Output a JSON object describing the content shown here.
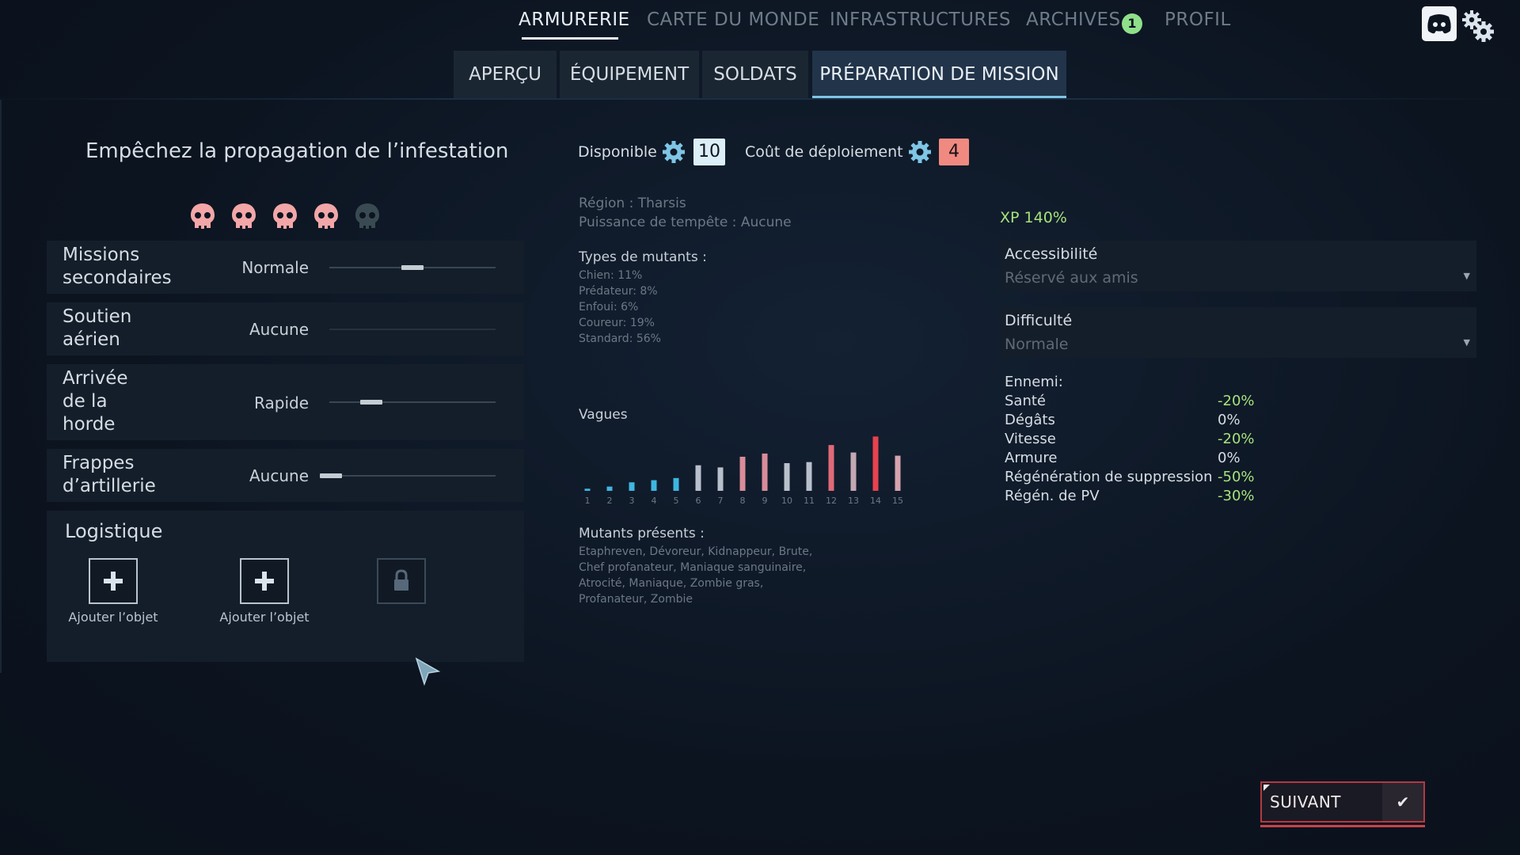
{
  "nav": {
    "items": [
      "ARMURERIE",
      "CARTE DU MONDE",
      "INFRASTRUCTURES",
      "ARCHIVES",
      "PROFIL"
    ],
    "active": "ARMURERIE",
    "archives_badge": "1"
  },
  "subtabs": [
    "APERÇU",
    "ÉQUIPEMENT",
    "SOLDATS",
    "PRÉPARATION DE MISSION"
  ],
  "active_subtab": "PRÉPARATION DE MISSION",
  "mission": {
    "title": "Empêchez la propagation de l’infestation",
    "difficulty_skulls_filled": 4,
    "difficulty_skulls_total": 5,
    "options": [
      {
        "label": "Missions secondaires",
        "value": "Normale",
        "level": 0.5
      },
      {
        "label": "Soutien aérien",
        "value": "Aucune",
        "level": null
      },
      {
        "label": "Arrivée de la horde",
        "value": "Rapide",
        "level": 0.25
      },
      {
        "label": "Frappes d’artillerie",
        "value": "Aucune",
        "level": 0.0
      }
    ],
    "logistics": {
      "title": "Logistique",
      "slots": [
        {
          "label": "Ajouter l’objet",
          "state": "add"
        },
        {
          "label": "Ajouter l’objet",
          "state": "add"
        },
        {
          "label": "",
          "state": "locked"
        }
      ]
    }
  },
  "resources": {
    "available_label": "Disponible",
    "available_value": "10",
    "cost_label": "Coût de déploiement",
    "cost_value": "4"
  },
  "info": {
    "region": "Région : Tharsis",
    "storm": "Puissance de tempête :  Aucune",
    "mutant_types_title": "Types de mutants :",
    "mutant_types": [
      "Chien:  11%",
      "Prédateur:  8%",
      "Enfoui:  6%",
      "Coureur:  19%",
      "Standard:  56%"
    ],
    "waves_title": "Vagues",
    "present_title": "Mutants présents :",
    "present_lines": [
      "Etaphreven, Dévoreur, Kidnappeur, Brute,",
      "Chef profanateur, Maniaque sanguinaire,",
      "Atrocité, Maniaque, Zombie gras,",
      "Profanateur, Zombie"
    ]
  },
  "chart_data": {
    "type": "bar",
    "categories": [
      "1",
      "2",
      "3",
      "4",
      "5",
      "6",
      "7",
      "8",
      "9",
      "10",
      "11",
      "12",
      "13",
      "14",
      "15"
    ],
    "values": [
      2,
      4,
      8,
      10,
      12,
      24,
      22,
      32,
      35,
      26,
      27,
      43,
      36,
      51,
      33
    ],
    "colors": [
      "#3fb7e0",
      "#3fb7e0",
      "#3fb7e0",
      "#3fb7e0",
      "#3fb7e0",
      "#b8c0cc",
      "#b8c0cc",
      "#d98c9a",
      "#d98c9a",
      "#b8c0cc",
      "#b8c0cc",
      "#e06a78",
      "#c4a8b4",
      "#e8424e",
      "#d6a3ae"
    ],
    "title": "Vagues",
    "xlabel": "",
    "ylabel": "",
    "ylim": [
      0,
      55
    ]
  },
  "settings": {
    "xp": "XP 140%",
    "accessibility_label": "Accessibilité",
    "accessibility_value": "Réservé aux amis",
    "difficulty_label": "Difficulté",
    "difficulty_value": "Normale"
  },
  "enemy": {
    "title": "Ennemi:",
    "rows": [
      {
        "label": "Santé",
        "value": "-20%",
        "color": "#a6e27a"
      },
      {
        "label": "Dégâts",
        "value": "0%",
        "color": "#d6dde4"
      },
      {
        "label": "Vitesse",
        "value": "-20%",
        "color": "#a6e27a"
      },
      {
        "label": "Armure",
        "value": "0%",
        "color": "#d6dde4"
      },
      {
        "label": "Régénération de suppression",
        "value": "-50%",
        "color": "#a6e27a"
      },
      {
        "label": "Régén. de PV",
        "value": "-30%",
        "color": "#a6e27a"
      }
    ]
  },
  "footer": {
    "next_label": "SUIVANT",
    "next_icon": "check-icon"
  },
  "colors": {
    "accent_blue": "#7fc5e6",
    "skull_active": "#f2a6a8",
    "skull_inactive": "#3a4a52",
    "positive": "#a6e27a",
    "next_border": "#b23a40"
  }
}
